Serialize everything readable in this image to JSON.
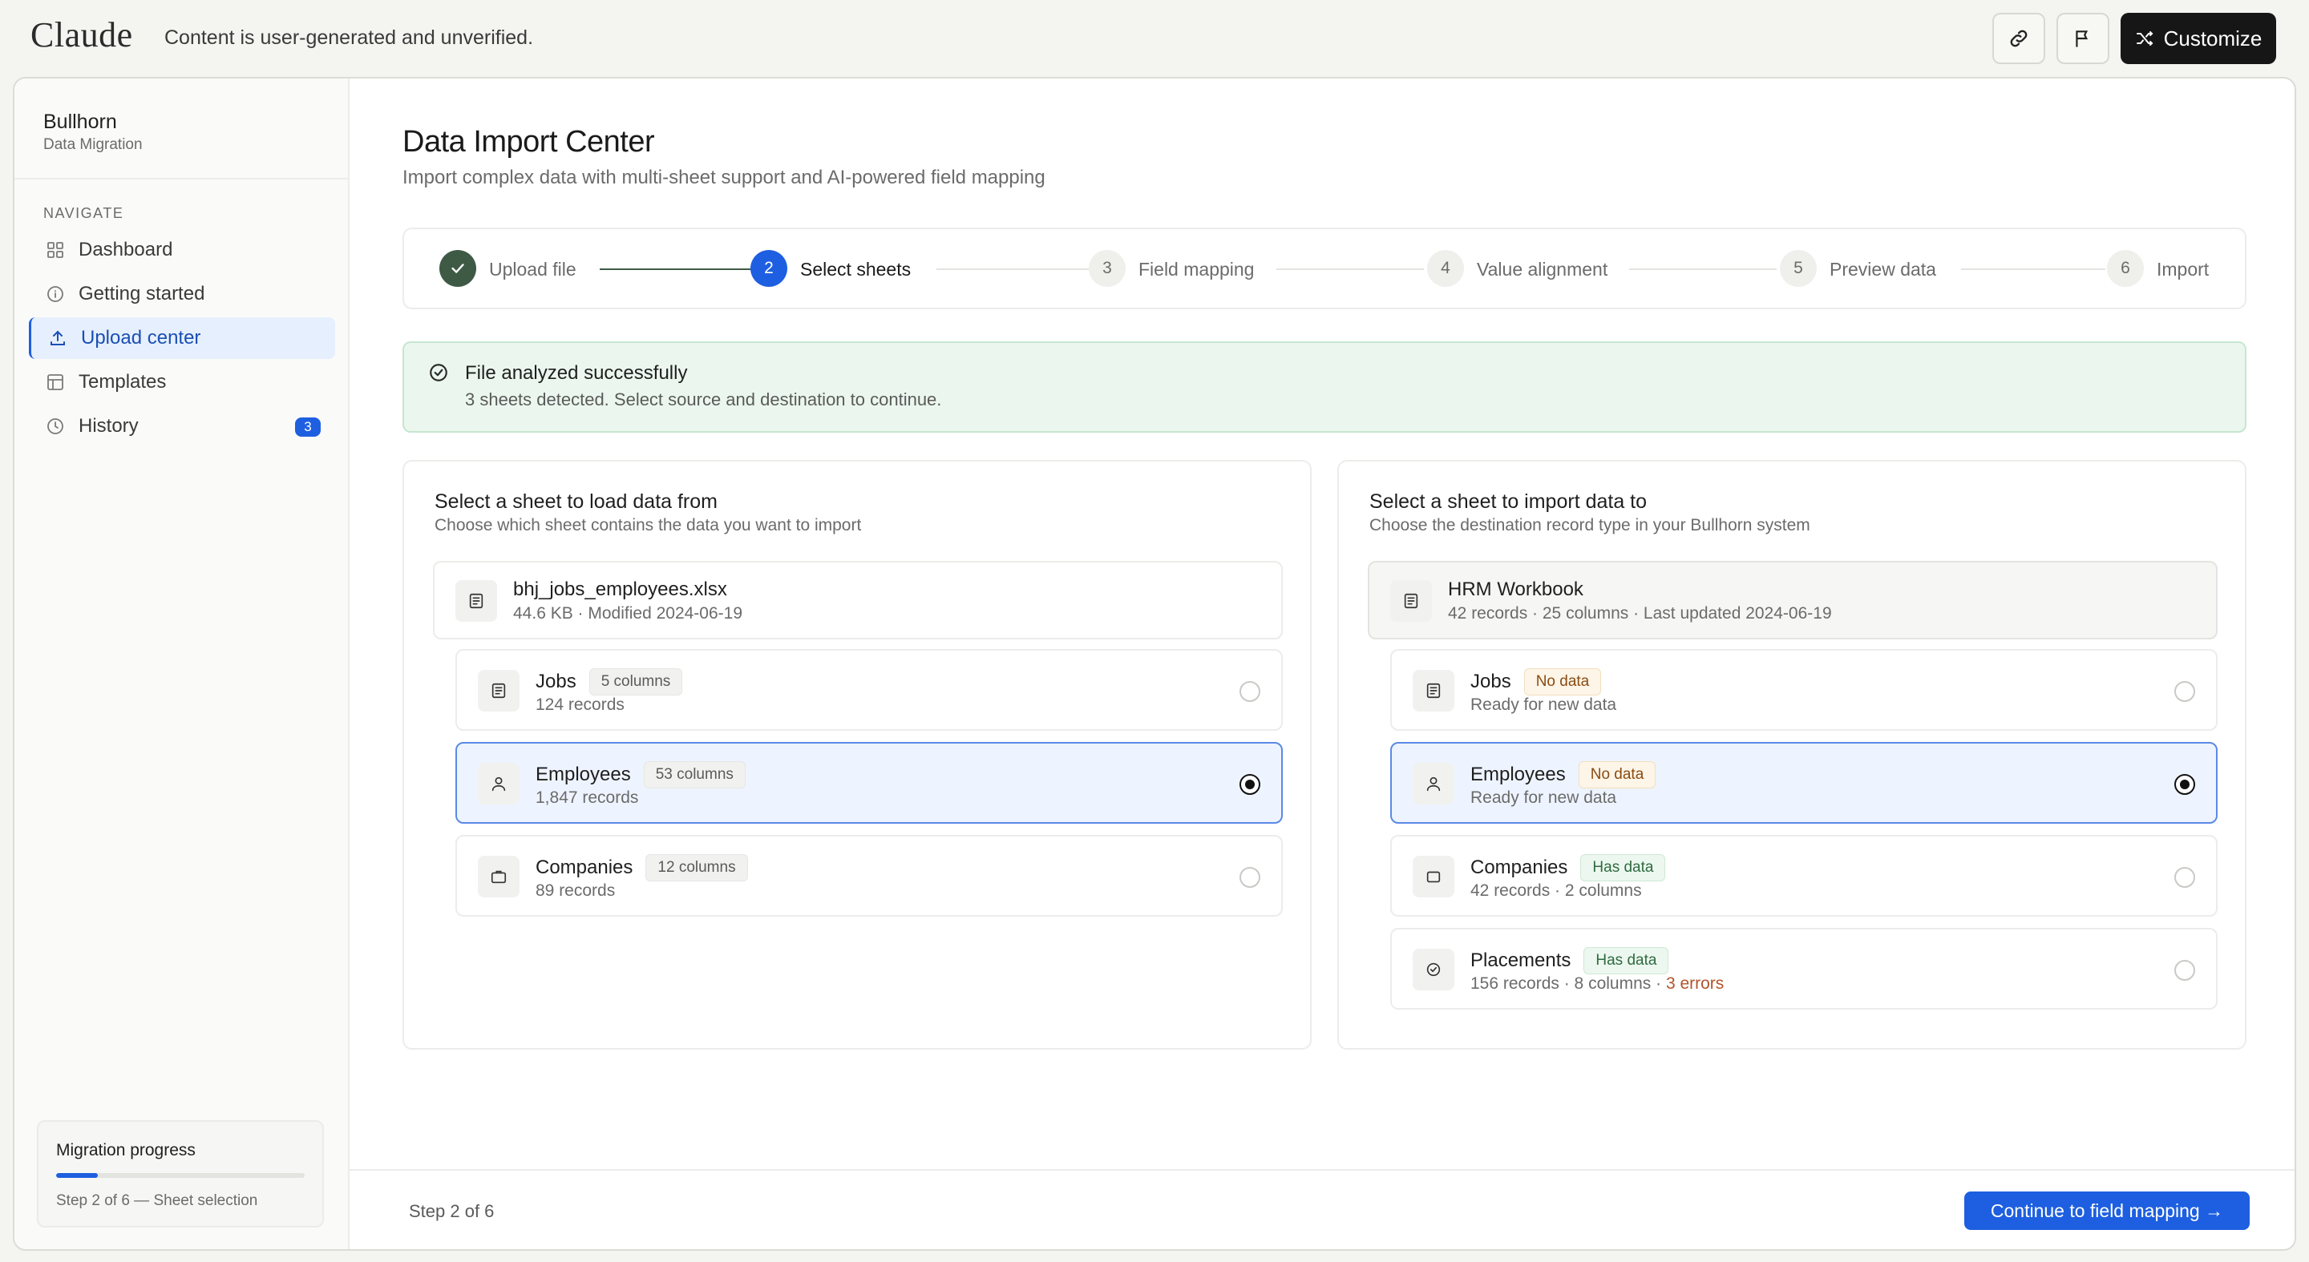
{
  "topbar": {
    "logo": "Claude",
    "disclaimer": "Content is user-generated and unverified.",
    "customize_label": "Customize"
  },
  "sidebar": {
    "brand": "Bullhorn",
    "brand_sub": "Data Migration",
    "nav_heading": "NAVIGATE",
    "items": [
      {
        "label": "Dashboard",
        "icon": "grid-icon"
      },
      {
        "label": "Getting started",
        "icon": "info-icon"
      },
      {
        "label": "Upload center",
        "icon": "upload-icon",
        "active": true
      },
      {
        "label": "Templates",
        "icon": "layout-icon"
      },
      {
        "label": "History",
        "icon": "clock-icon",
        "badge": "3"
      }
    ],
    "progress": {
      "title": "Migration progress",
      "fraction": 0.167,
      "note": "Step 2 of 6 — Sheet selection"
    }
  },
  "main": {
    "title": "Data Import Center",
    "subtitle": "Import complex data with multi-sheet support and AI-powered field mapping",
    "steps": [
      {
        "num": "1",
        "label": "Upload file",
        "state": "done"
      },
      {
        "num": "2",
        "label": "Select sheets",
        "state": "current"
      },
      {
        "num": "3",
        "label": "Field mapping",
        "state": "todo"
      },
      {
        "num": "4",
        "label": "Value alignment",
        "state": "todo"
      },
      {
        "num": "5",
        "label": "Preview data",
        "state": "todo"
      },
      {
        "num": "6",
        "label": "Import",
        "state": "todo"
      }
    ],
    "alert": {
      "title": "File analyzed successfully",
      "message": "3 sheets detected. Select source and destination to continue."
    },
    "source": {
      "title": "Select a sheet to load data from",
      "subtitle": "Choose which sheet contains the data you want to import",
      "file_name": "bhj_jobs_employees.xlsx",
      "file_meta": "44.6 KB · Modified 2024-06-19",
      "sheets": [
        {
          "name": "Jobs",
          "pill": "5 columns",
          "meta": "124 records",
          "selected": false
        },
        {
          "name": "Employees",
          "pill": "53 columns",
          "meta": "1,847 records",
          "selected": true
        },
        {
          "name": "Companies",
          "pill": "12 columns",
          "meta": "89 records",
          "selected": false
        }
      ]
    },
    "destination": {
      "title": "Select a sheet to import data to",
      "subtitle": "Choose the destination record type in your Bullhorn system",
      "workbook_name": "HRM Workbook",
      "workbook_meta": "42 records · 25 columns · Last updated 2024-06-19",
      "sheets": [
        {
          "name": "Jobs",
          "pill": "No data",
          "meta": "Ready for new data",
          "selected": false
        },
        {
          "name": "Employees",
          "pill": "No data",
          "meta": "Ready for new data",
          "selected": true
        },
        {
          "name": "Companies",
          "pill": "Has data",
          "meta": "42 records · 2 columns",
          "selected": false
        },
        {
          "name": "Placements",
          "pill": "Has data",
          "meta": "156 records · 8 columns · ",
          "errors": "3 errors",
          "selected": false
        }
      ]
    },
    "footer": {
      "step_text": "Step 2 of 6",
      "continue_label": "Continue to field mapping →"
    }
  },
  "colors": {
    "accent": "#1d5fe0",
    "done": "#3e5a45",
    "success_bg": "#ebf7ee",
    "warning_text": "#8a4b12",
    "error_text": "#b2542a"
  }
}
